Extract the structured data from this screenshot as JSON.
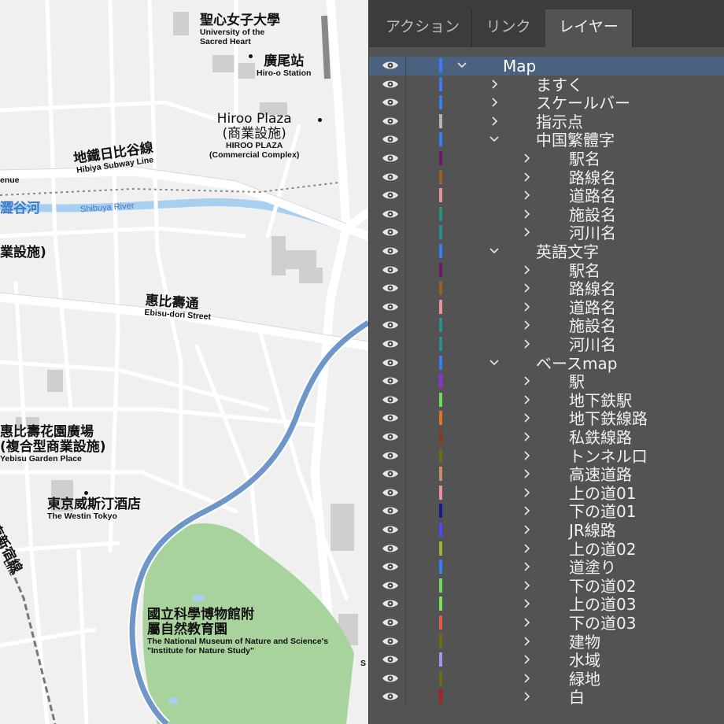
{
  "panel": {
    "tabs": [
      {
        "label": "アクション",
        "active": false
      },
      {
        "label": "リンク",
        "active": false
      },
      {
        "label": "レイヤー",
        "active": true
      }
    ],
    "layers": [
      {
        "name": "Map",
        "depth": 0,
        "expanded": true,
        "color": "#3b7bf2",
        "selected": true
      },
      {
        "name": "ますく",
        "depth": 1,
        "expanded": false,
        "color": "#3b7bf2"
      },
      {
        "name": "スケールバー",
        "depth": 1,
        "expanded": false,
        "color": "#3b7bf2"
      },
      {
        "name": "指示点",
        "depth": 1,
        "expanded": false,
        "color": "#b4b4b4"
      },
      {
        "name": "中国繁體字",
        "depth": 1,
        "expanded": true,
        "color": "#3b7bf2"
      },
      {
        "name": "駅名",
        "depth": 2,
        "expanded": false,
        "color": "#6b1a6f"
      },
      {
        "name": "路線名",
        "depth": 2,
        "expanded": false,
        "color": "#9a5e26"
      },
      {
        "name": "道路名",
        "depth": 2,
        "expanded": false,
        "color": "#e7919a"
      },
      {
        "name": "施設名",
        "depth": 2,
        "expanded": false,
        "color": "#2b8f8c"
      },
      {
        "name": "河川名",
        "depth": 2,
        "expanded": false,
        "color": "#2b8f8c"
      },
      {
        "name": "英語文字",
        "depth": 1,
        "expanded": true,
        "color": "#3b7bf2"
      },
      {
        "name": "駅名",
        "depth": 2,
        "expanded": false,
        "color": "#6b1a6f"
      },
      {
        "name": "路線名",
        "depth": 2,
        "expanded": false,
        "color": "#9a5e26"
      },
      {
        "name": "道路名",
        "depth": 2,
        "expanded": false,
        "color": "#e7919a"
      },
      {
        "name": "施設名",
        "depth": 2,
        "expanded": false,
        "color": "#2b8f8c"
      },
      {
        "name": "河川名",
        "depth": 2,
        "expanded": false,
        "color": "#2b8f8c"
      },
      {
        "name": "ベースmap",
        "depth": 1,
        "expanded": true,
        "color": "#3b7bf2"
      },
      {
        "name": "駅",
        "depth": 2,
        "expanded": false,
        "color": "#8d2ce6"
      },
      {
        "name": "地下鉄駅",
        "depth": 2,
        "expanded": false,
        "color": "#6ddc5a"
      },
      {
        "name": "地下鉄線路",
        "depth": 2,
        "expanded": false,
        "color": "#e8702e"
      },
      {
        "name": "私鉄線路",
        "depth": 2,
        "expanded": false,
        "color": "#8a3a1e"
      },
      {
        "name": "トンネル口",
        "depth": 2,
        "expanded": false,
        "color": "#6b6b16"
      },
      {
        "name": "高速道路",
        "depth": 2,
        "expanded": false,
        "color": "#c98e6a"
      },
      {
        "name": "上の道01",
        "depth": 2,
        "expanded": false,
        "color": "#e7919a"
      },
      {
        "name": "下の道01",
        "depth": 2,
        "expanded": false,
        "color": "#1a1a8c"
      },
      {
        "name": "JR線路",
        "depth": 2,
        "expanded": false,
        "color": "#4a4aff"
      },
      {
        "name": "上の道02",
        "depth": 2,
        "expanded": false,
        "color": "#9ab43a"
      },
      {
        "name": "道塗り",
        "depth": 2,
        "expanded": false,
        "color": "#3b7bf2"
      },
      {
        "name": "下の道02",
        "depth": 2,
        "expanded": false,
        "color": "#6ddc5a"
      },
      {
        "name": "上の道03",
        "depth": 2,
        "expanded": false,
        "color": "#7ee05a"
      },
      {
        "name": "下の道03",
        "depth": 2,
        "expanded": false,
        "color": "#e05a4a"
      },
      {
        "name": "建物",
        "depth": 2,
        "expanded": false,
        "color": "#6b6b16"
      },
      {
        "name": "水域",
        "depth": 2,
        "expanded": false,
        "color": "#9a9af0"
      },
      {
        "name": "緑地",
        "depth": 2,
        "expanded": false,
        "color": "#6b6b16"
      },
      {
        "name": "白",
        "depth": 2,
        "expanded": false,
        "color": "#b01e1e"
      }
    ]
  },
  "map": {
    "labels": {
      "sacred_heart_zh": "聖心女子大學",
      "sacred_heart_en1": "University of the",
      "sacred_heart_en2": "Sacred Heart",
      "hiroo_station_zh": "廣尾站",
      "hiroo_station_en": "Hiro-o Station",
      "hiroo_plaza_1": "Hiroo Plaza",
      "hiroo_plaza_2": "(商業設施)",
      "hiroo_plaza_en1": "HIROO PLAZA",
      "hiroo_plaza_en2": "(Commercial Complex)",
      "hibiya_zh": "地鐵日比谷線",
      "hibiya_en": "Hibiya Subway Line",
      "avenue_fragment": "enue",
      "shibuya_river_zh": "澀谷河",
      "shibuya_river_en": "Shibuya River",
      "commercial_fragment": "業設施)",
      "ebisu_dori_zh": "惠比壽通",
      "ebisu_dori_en": "Ebisu-dori Street",
      "garden_place_zh1": "惠比壽花園廣場",
      "garden_place_zh2": "(複合型商業設施)",
      "garden_place_en": "Yebisu Garden Place",
      "westin_zh": "東京威斯汀酒店",
      "westin_en": "The Westin Tokyo",
      "shinjuku_line_zh": "湘南新宿線",
      "line_en_fragment": "Line",
      "museum_zh1": "國立科學博物館附",
      "museum_zh2": "屬自然教育園",
      "museum_en1": "The National Museum of Nature and Science's",
      "museum_en2": "\"Institute for Nature Study\"",
      "edge_fragment": "S"
    }
  }
}
